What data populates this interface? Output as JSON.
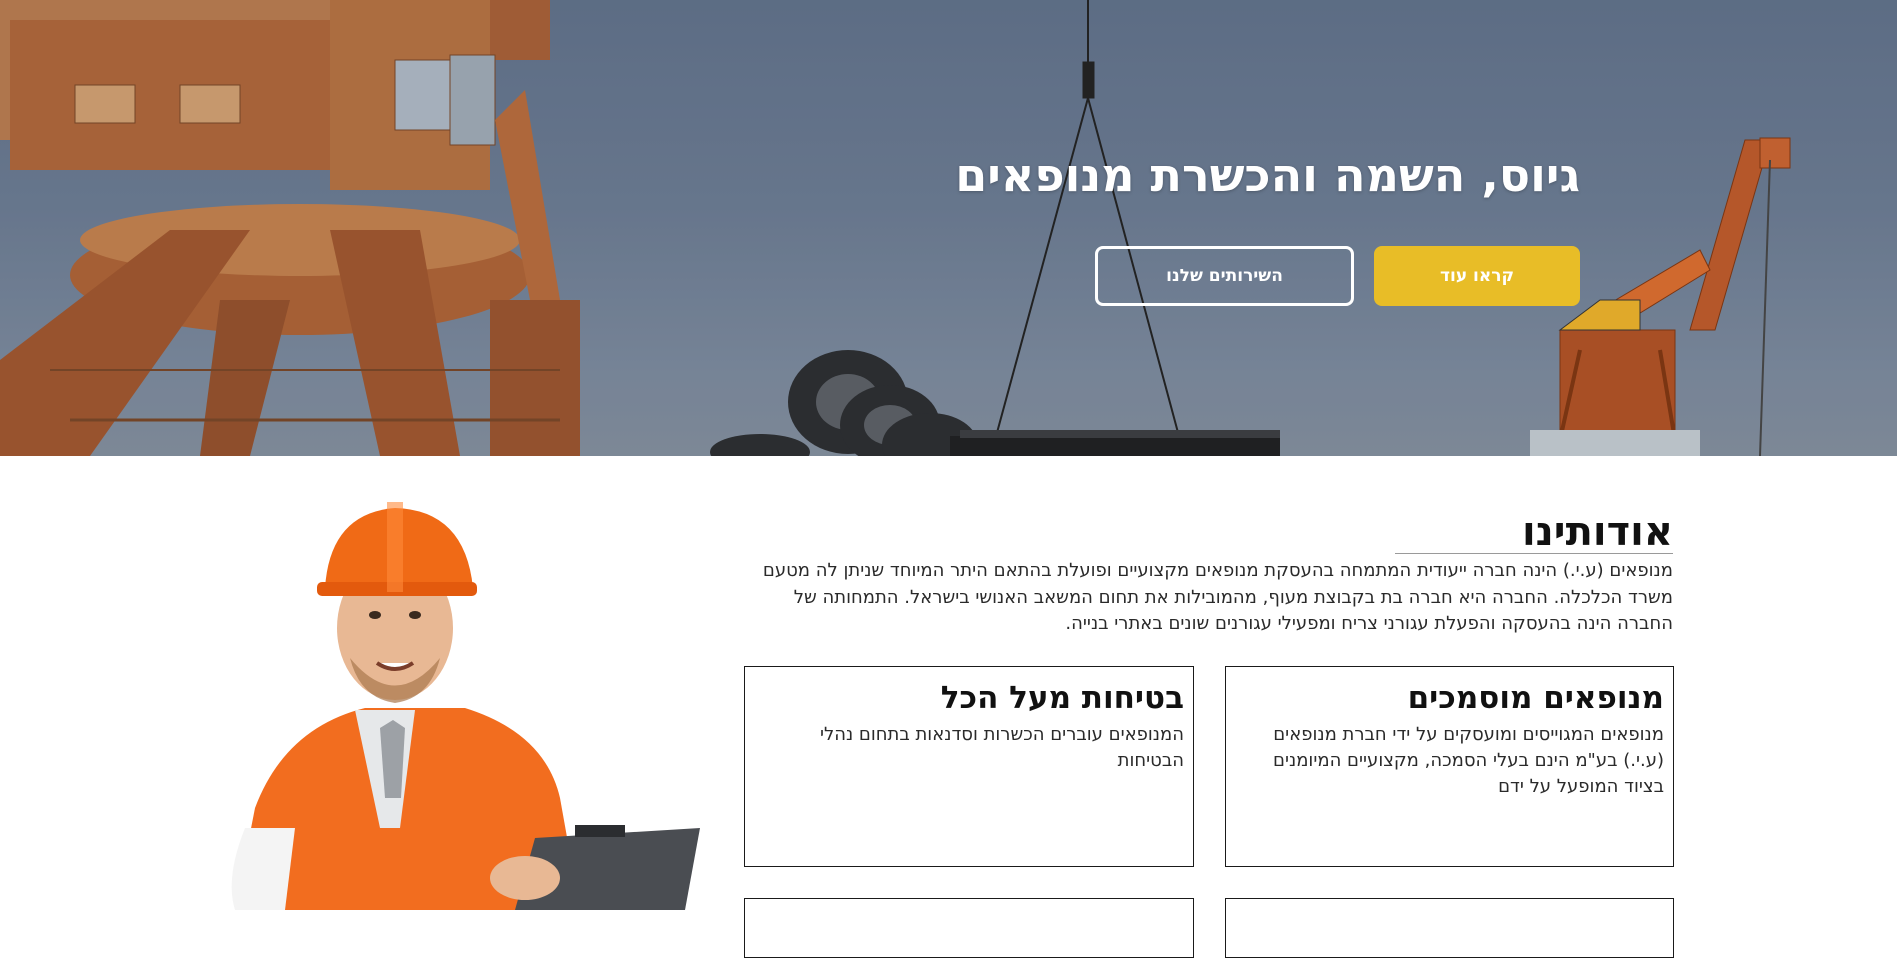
{
  "hero": {
    "title": "גיוס, השמה והכשרת מנופאים",
    "primary_button": "קראו עוד",
    "secondary_button": "השירותים שלנו"
  },
  "about": {
    "title": "אודותינו",
    "paragraph": "מנופאים (ע.י.) הינה חברה ייעודית המתמחה בהעסקת מנופאים מקצועיים ופועלת בהתאם היתר המיוחד שניתן לה מטעם משרד הכלכלה. החברה היא חברה בת בקבוצת מעוף, מהמובילות את תחום המשאב האנושי בישראל. התמחותה של החברה הינה בהעסקה והפעלת עגורני צריח ומפעילי עגורנים שונים באתרי בנייה.",
    "cards": [
      {
        "title": "מנופאים מוסמכים",
        "text": "מנופאים המגוייסים ומועסקים על ידי חברת מנופאים (ע.י.) בע\"מ הינם בעלי הסמכה, מקצועיים המיומנים בציוד המופעל על ידם"
      },
      {
        "title": "בטיחות מעל הכל",
        "text": "המנופאים עוברים הכשרות וסדנאות בתחום נהלי הבטיחות"
      }
    ]
  },
  "colors": {
    "accent": "#e8bd27",
    "hero_overlay": "#6b7a8f",
    "crane": "#c86a2a"
  },
  "images": {
    "hero_background": "harbour-cranes-photo",
    "worker": "construction-worker-photo"
  }
}
